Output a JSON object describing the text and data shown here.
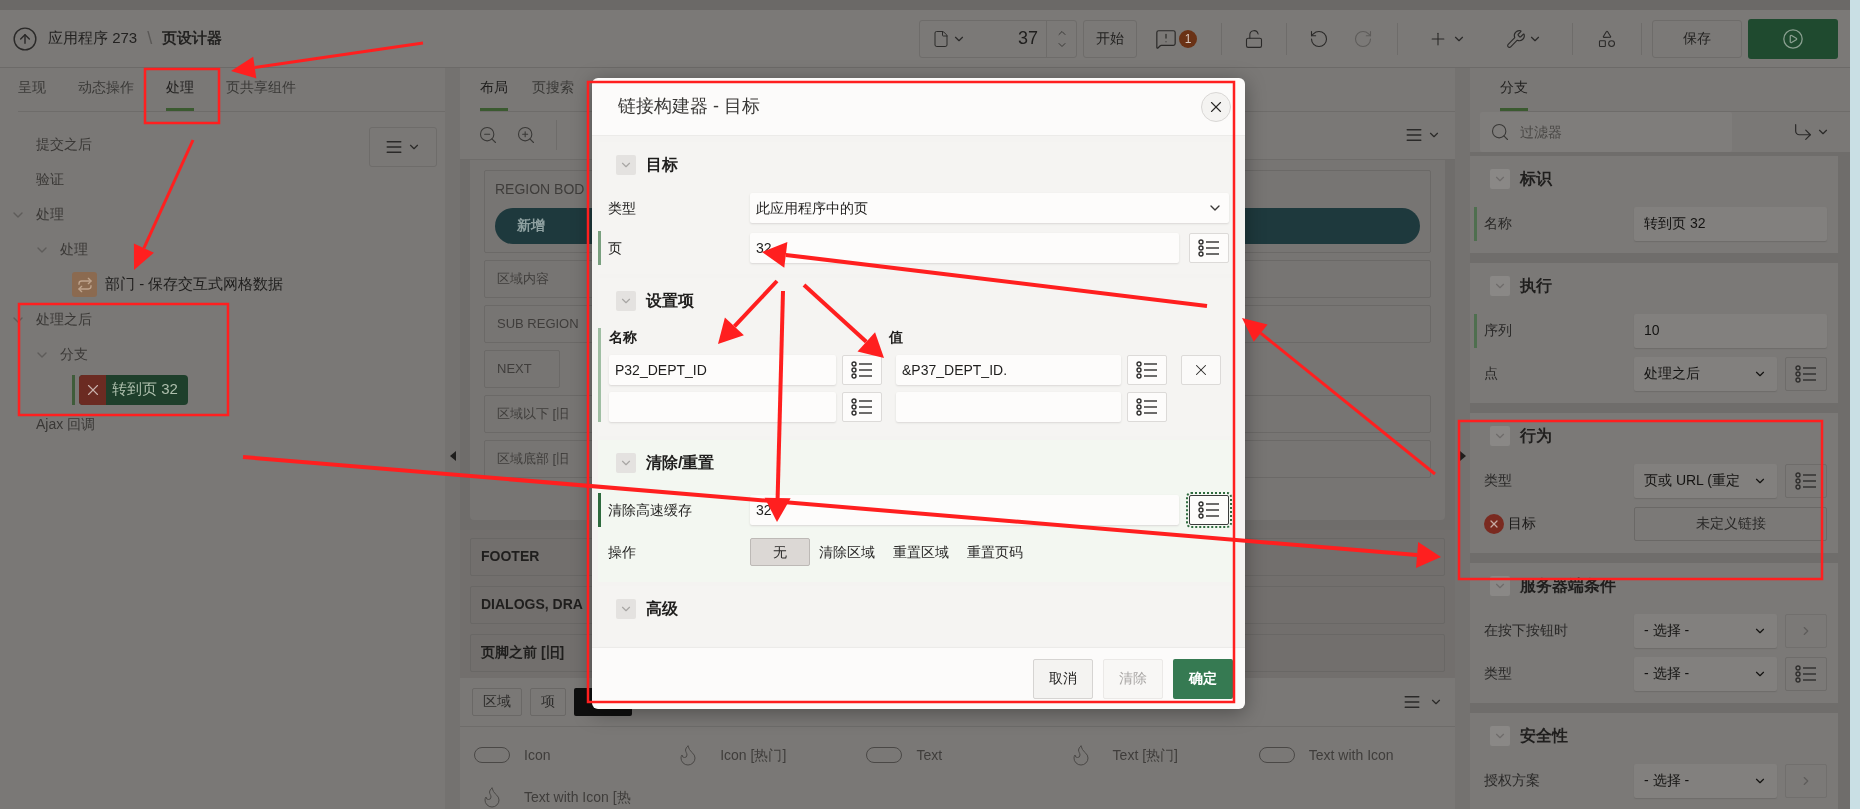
{
  "header": {
    "app": "应用程序 273",
    "separator": "\\",
    "page_designer": "页设计器",
    "page_number": "37",
    "start_button": "开始",
    "warning_count": "1",
    "save_button": "保存"
  },
  "left_panel": {
    "tabs": [
      {
        "label": "呈现",
        "selected": false
      },
      {
        "label": "动态操作",
        "selected": false
      },
      {
        "label": "处理",
        "selected": true
      },
      {
        "label": "页共享组件",
        "selected": false
      }
    ],
    "tree": [
      {
        "label": "提交之后",
        "kind": "group",
        "selected": false,
        "error": false
      },
      {
        "label": "验证",
        "kind": "group",
        "selected": false,
        "error": false
      },
      {
        "label": "处理",
        "kind": "group",
        "selected": false,
        "error": false,
        "expanded": true,
        "children": [
          {
            "label": "处理",
            "kind": "group",
            "selected": false,
            "error": false,
            "expanded": true,
            "children": [
              {
                "label": "部门 - 保存交互式网格数据",
                "kind": "process",
                "selected": false,
                "error": false
              }
            ]
          }
        ]
      },
      {
        "label": "处理之后",
        "kind": "group",
        "selected": false,
        "error": false,
        "expanded": true,
        "children": [
          {
            "label": "分支",
            "kind": "group",
            "selected": false,
            "error": false,
            "expanded": true,
            "children": [
              {
                "label": "转到页 32",
                "kind": "branch",
                "selected": true,
                "error": true
              }
            ]
          }
        ]
      },
      {
        "label": "Ajax 回调",
        "kind": "group",
        "selected": false,
        "error": false
      }
    ]
  },
  "layout_panel": {
    "tabs": [
      {
        "label": "布局",
        "selected": true
      },
      {
        "label": "页搜索",
        "selected": false
      }
    ],
    "region_body": "REGION BOD",
    "new_button": "新增",
    "slots": [
      "区域内容",
      "SUB REGION",
      "NEXT",
      "区域以下 [旧",
      "区域底部 [旧"
    ],
    "page_sections": [
      "FOOTER",
      "DIALOGS, DRA",
      "页脚之前 [旧]"
    ],
    "gallery_tabs": [
      {
        "label": "区域",
        "selected": false
      },
      {
        "label": "项",
        "selected": false
      },
      {
        "selected": true
      }
    ],
    "gallery": [
      {
        "label": "Icon",
        "kind": "pill"
      },
      {
        "label": "Icon [热门]",
        "kind": "flame"
      },
      {
        "label": "Text",
        "kind": "pill"
      },
      {
        "label": "Text [热门]",
        "kind": "flame"
      },
      {
        "label": "Text with Icon",
        "kind": "pill"
      },
      {
        "label": "Text with Icon [热",
        "kind": "flame"
      }
    ]
  },
  "dialog": {
    "title": "链接构建器 - 目标",
    "target": {
      "title": "目标",
      "type_label": "类型",
      "type_value": "此应用程序中的页",
      "page_label": "页",
      "page_value": "32"
    },
    "items": {
      "title": "设置项",
      "name_header": "名称",
      "value_header": "值",
      "rows": [
        {
          "name": "P32_DEPT_ID",
          "value": "&P37_DEPT_ID."
        }
      ]
    },
    "clear": {
      "title": "清除/重置",
      "cache_label": "清除高速缓存",
      "cache_value": "32",
      "action_label": "操作",
      "actions": [
        {
          "label": "无",
          "selected": true
        },
        {
          "label": "清除区域",
          "selected": false
        },
        {
          "label": "重置区域",
          "selected": false
        },
        {
          "label": "重置页码",
          "selected": false
        }
      ]
    },
    "advanced": {
      "title": "高级"
    },
    "buttons": [
      {
        "label": "取消",
        "kind": "default"
      },
      {
        "label": "清除",
        "kind": "disabled"
      },
      {
        "label": "确定",
        "kind": "primary"
      }
    ]
  },
  "property_panel": {
    "tabs": [
      {
        "label": "分支",
        "selected": true
      }
    ],
    "filter_placeholder": "过滤器",
    "sections": [
      {
        "title": "标识",
        "rows": [
          {
            "label": "名称",
            "kind": "text",
            "value": "转到页 32",
            "required": true,
            "error": false
          }
        ]
      },
      {
        "title": "执行",
        "rows": [
          {
            "label": "序列",
            "kind": "text",
            "value": "10",
            "required": true,
            "error": false
          },
          {
            "label": "点",
            "kind": "select",
            "value": "处理之后",
            "side": {
              "kind": "list"
            },
            "required": false,
            "error": false
          }
        ]
      },
      {
        "title": "行为",
        "rows": [
          {
            "label": "类型",
            "kind": "select",
            "value": "页或 URL (重定",
            "side": {
              "kind": "list"
            },
            "required": false,
            "error": false
          },
          {
            "label": "目标",
            "kind": "link",
            "value": "未定义链接",
            "required": false,
            "error": true
          }
        ]
      },
      {
        "title": "服务器端条件",
        "rows": [
          {
            "label": "在按下按钮时",
            "kind": "select",
            "value": "- 选择 -",
            "side": {
              "kind": "next"
            },
            "required": false,
            "error": false
          },
          {
            "label": "类型",
            "kind": "select",
            "value": "- 选择 -",
            "side": {
              "kind": "list"
            },
            "required": false,
            "error": false
          }
        ]
      },
      {
        "title": "安全性",
        "rows": [
          {
            "label": "授权方案",
            "kind": "select",
            "value": "- 选择 -",
            "side": {
              "kind": "next"
            },
            "required": false,
            "error": false
          }
        ]
      }
    ]
  }
}
